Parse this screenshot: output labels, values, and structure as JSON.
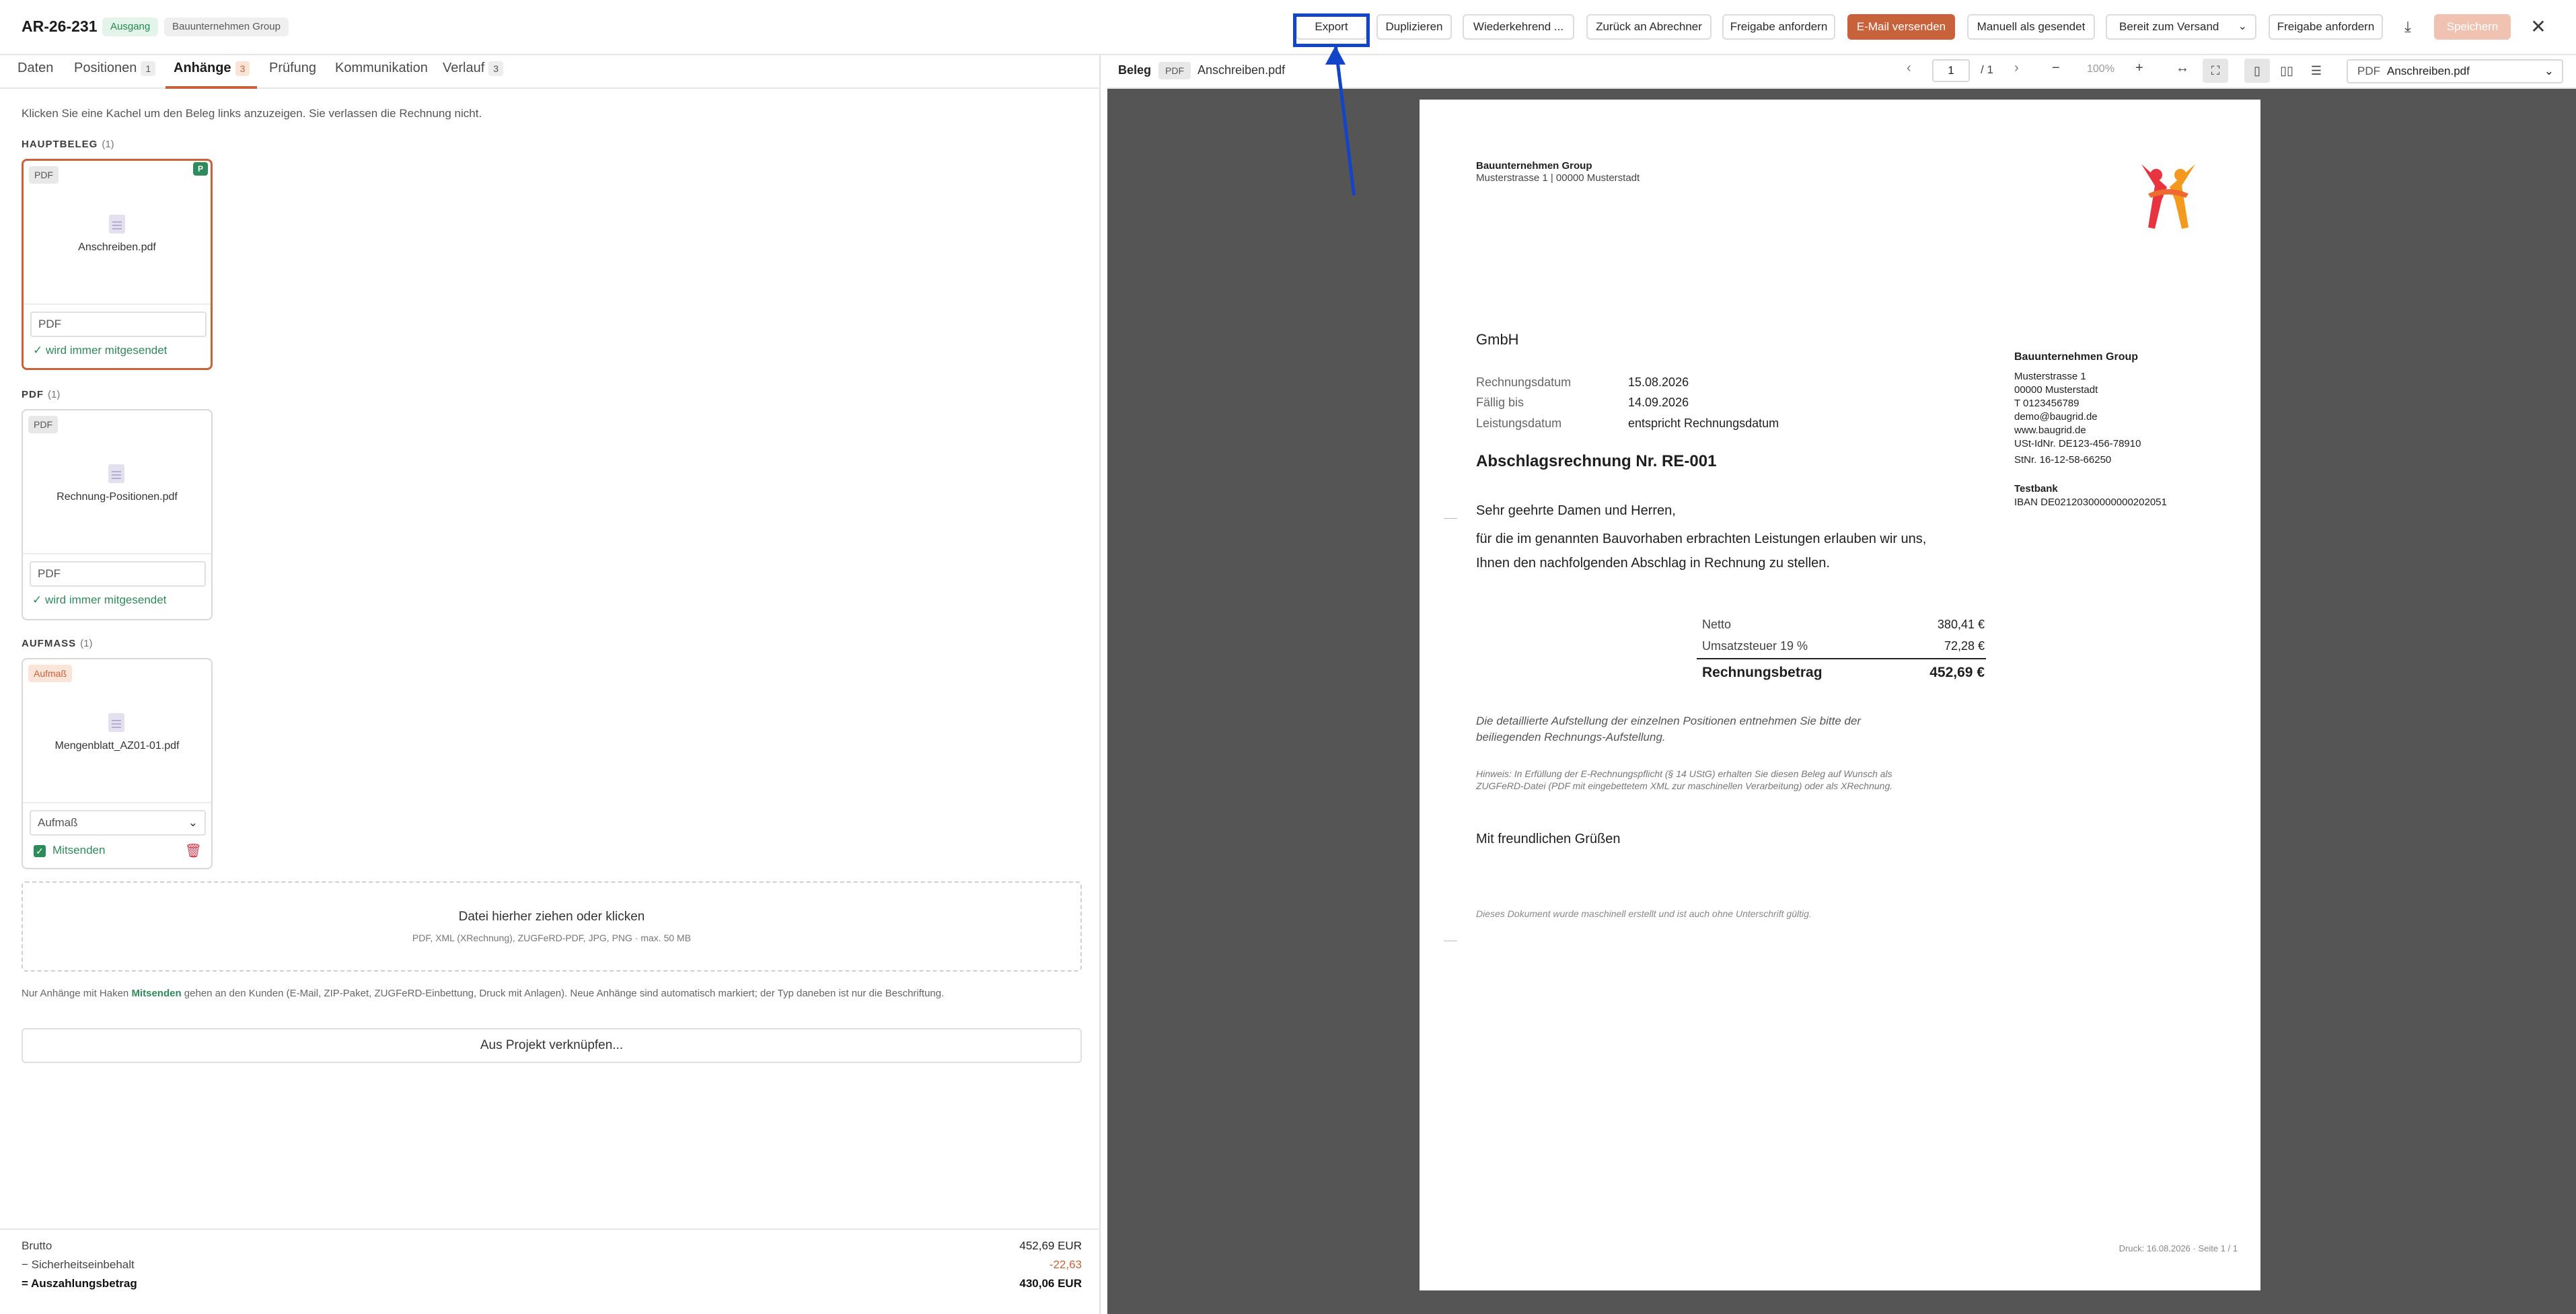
{
  "header": {
    "doc_id": "AR-26-231",
    "tag_direction": "Ausgang",
    "tag_company": "Bauunternehmen Group",
    "buttons": {
      "export": "Export",
      "duplicate": "Duplizieren",
      "recurring": "Wiederkehrend ...",
      "back_to_billing": "Zurück an Abrechner",
      "request_approval": "Freigabe anfordern",
      "send_email": "E-Mail versenden",
      "mark_sent": "Manuell als gesendet",
      "status_select": "Bereit zum Versand",
      "request_approval_2": "Freigabe anfordern",
      "save": "Speichern"
    },
    "icons": {
      "download": "download-icon",
      "close": "close-icon"
    }
  },
  "tabs": [
    {
      "label": "Daten",
      "count": ""
    },
    {
      "label": "Positionen",
      "count": "1"
    },
    {
      "label": "Anhänge",
      "count": "3"
    },
    {
      "label": "Prüfung",
      "count": ""
    },
    {
      "label": "Kommunikation",
      "count": ""
    },
    {
      "label": "Verlauf",
      "count": "3"
    }
  ],
  "attachments": {
    "hint": "Klicken Sie eine Kachel um den Beleg links anzuzeigen. Sie verlassen die Rechnung nicht.",
    "sections": [
      {
        "title": "HAUPTBELEG",
        "count": "(1)",
        "card": {
          "type_badge": "PDF",
          "main_badge": "P",
          "filename": "Anschreiben.pdf",
          "type_value": "PDF",
          "status": "✓ wird immer mitgesendet"
        }
      },
      {
        "title": "PDF",
        "count": "(1)",
        "card": {
          "type_badge": "PDF",
          "filename": "Rechnung-Positionen.pdf",
          "type_value": "PDF",
          "status": "✓ wird immer mitgesendet"
        }
      },
      {
        "title": "AUFMASS",
        "count": "(1)",
        "card": {
          "type_badge": "Aufmaß",
          "filename": "Mengenblatt_AZ01-01.pdf",
          "type_value": "Aufmaß",
          "send_label": "Mitsenden"
        }
      }
    ],
    "dropzone_title": "Datei hierher ziehen oder klicken",
    "dropzone_sub": "PDF, XML (XRechnung), ZUGFeRD-PDF, JPG, PNG · max. 50 MB",
    "note_prefix": "Nur Anhänge mit Haken ",
    "note_bold": "Mitsenden",
    "note_suffix": " gehen an den Kunden (E-Mail, ZIP-Paket, ZUGFeRD-Einbettung, Druck mit Anlagen). Neue Anhänge sind automatisch markiert; der Typ daneben ist nur die Beschriftung.",
    "link_project": "Aus Projekt verknüpfen..."
  },
  "totals": {
    "gross_label": "Brutto",
    "gross_value": "452,69 EUR",
    "retention_label": "− Sicherheitseinbehalt",
    "retention_value": "-22,63",
    "payout_label": "= Auszahlungsbetrag",
    "payout_value": "430,06 EUR"
  },
  "viewer": {
    "label": "Beleg",
    "type": "PDF",
    "file": "Anschreiben.pdf",
    "page_current": "1",
    "page_total": "/ 1",
    "zoom": "100%",
    "select_prefix": "PDF",
    "select_value": "Anschreiben.pdf"
  },
  "document": {
    "sender_name": "Bauunternehmen Group",
    "sender_address": "Musterstrasse 1 | 00000 Musterstadt",
    "recipient": "GmbH",
    "meta": [
      {
        "label": "Rechnungsdatum",
        "value": "15.08.2026"
      },
      {
        "label": "Fällig bis",
        "value": "14.09.2026"
      },
      {
        "label": "Leistungsdatum",
        "value": "entspricht Rechnungsdatum"
      }
    ],
    "title": "Abschlagsrechnung Nr. RE-001",
    "salutation": "Sehr geehrte Damen und Herren,",
    "body_1": "für die im genannten Bauvorhaben erbrachten Leistungen erlauben wir uns,",
    "body_2": "Ihnen den nachfolgenden Abschlag in Rechnung zu stellen.",
    "sums": {
      "net_label": "Netto",
      "net_value": "380,41 €",
      "vat_label": "Umsatzsteuer 19 %",
      "vat_value": "72,28 €",
      "total_label": "Rechnungsbetrag",
      "total_value": "452,69 €"
    },
    "italic_1": "Die detaillierte Aufstellung der einzelnen Positionen entnehmen Sie bitte der",
    "italic_2": "beiliegenden Rechnungs-Aufstellung.",
    "hint_1": "Hinweis: In Erfüllung der E-Rechnungspflicht (§ 14 UStG) erhalten Sie diesen Beleg auf Wunsch als",
    "hint_2": "ZUGFeRD-Datei (PDF mit eingebettetem XML zur maschinellen Verarbeitung) oder als XRechnung.",
    "closing": "Mit freundlichen Grüßen",
    "footer_note": "Dieses Dokument wurde maschinell erstellt und ist auch ohne Unterschrift gültig.",
    "print_info": "Druck: 16.08.2026 · Seite 1 / 1",
    "sidebar": {
      "company": "Bauunternehmen Group",
      "street": "Musterstrasse 1",
      "city": "00000 Musterstadt",
      "phone": "T 0123456789",
      "email": "demo@baugrid.de",
      "web": "www.baugrid.de",
      "vat_id": "USt-IdNr. DE123-456-78910",
      "tax_no": "StNr. 16-12-58-66250",
      "bank": "Testbank",
      "iban": "IBAN DE02120300000000202051"
    }
  },
  "colors": {
    "accent": "#c8623b",
    "success": "#2d8c5a",
    "annotation": "#1245c7",
    "viewer_bg": "#555555"
  }
}
